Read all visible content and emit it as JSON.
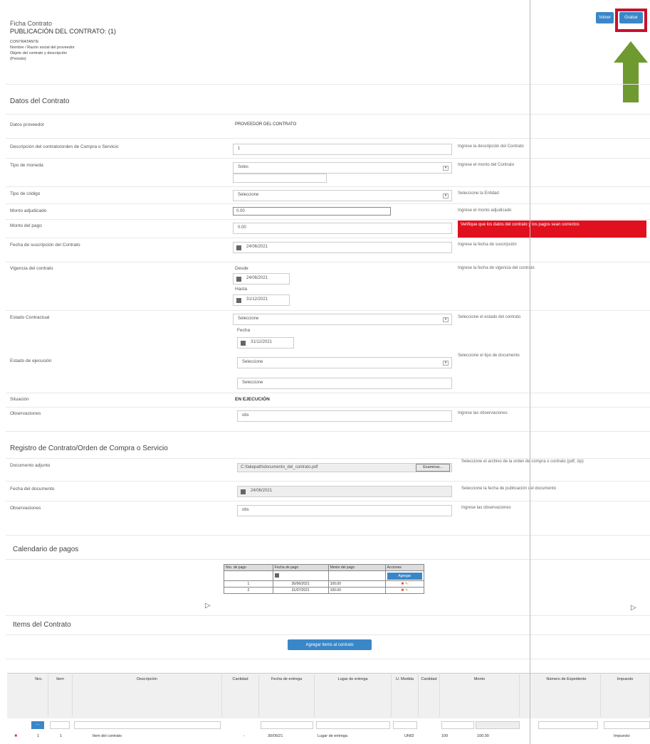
{
  "header": {
    "subtitle": "Ficha Contrato",
    "title": "PUBLICACIÓN DEL CONTRATO: (1)",
    "lines": [
      "CONTRATANTE",
      "Nombre / Razón social del proveedor",
      "Objeto del contrato y descripción",
      "(Periodo)"
    ]
  },
  "toolbar": {
    "back_label": "Volver",
    "save_label": "Grabar"
  },
  "sections": {
    "datos": "Datos del Contrato",
    "registro": "Registro de Contrato/Orden de Compra o Servicio",
    "calendario": "Calendario de pagos",
    "items": "Items del Contrato"
  },
  "form": {
    "proveedor_label": "Datos proveedor",
    "proveedor_value": "PROVEEDOR DEL CONTRATO",
    "descripcion_label": "Descripción del contrato/orden de Compra o Servicio",
    "descripcion_value": "1",
    "descripcion_help": "Ingrese la descripción del Contrato",
    "moneda_label": "Tipo de moneda",
    "moneda_value": "Soles",
    "moneda_help": "Ingrese el monto del Contrato",
    "codigo_label": "Tipo de código",
    "codigo_value": "Seleccione",
    "codigo_help": "Seleccione la Entidad",
    "monto_label": "Monto adjudicado",
    "monto_value": "0.00",
    "monto_help": "Ingrese el monto adjudicado",
    "pago_label": "Monto del pago",
    "pago_value": "0.00",
    "pago_alert": "Verifique que los datos del contrato y los pagos sean correctos",
    "fecha_label": "Fecha de suscripción del Contrato",
    "fecha_value": "24/06/2021",
    "fecha_help": "Ingrese la fecha de suscripción",
    "vigencia_label": "Vigencia del contrato",
    "vigencia_desde_label": "Desde",
    "vigencia_desde": "24/06/2021",
    "vigencia_hasta_label": "Hasta",
    "vigencia_hasta": "31/12/2021",
    "vigencia_help": "Ingrese la fecha de vigencia del contrato",
    "estado_label": "Estado Contractual",
    "estado_value": "Seleccione",
    "estado_help": "Seleccione el estado del contrato",
    "fecha2_label": "Fecha",
    "fecha2_value": "31/12/2021",
    "estado2_label": "Estado de ejecución",
    "estado2_value": "Seleccione",
    "estado2_help": "Seleccione el tipo de documento",
    "estado2_extra": "Seleccione",
    "situacion_label": "Situación",
    "situacion_value": "EN EJECUCIÓN",
    "obs_label": "Observaciones",
    "obs_value": "obs",
    "obs_help": "Ingrese las observaciones"
  },
  "registro": {
    "archivo_label": "Documento adjunto",
    "archivo_value": "C:\\fakepath\\documento_del_contrato.pdf",
    "archivo_button": "Examinar...",
    "archivo_help": "Seleccione el archivo de la orden de compra o contrato (pdf, zip)",
    "fecha_label": "Fecha del documento",
    "fecha_value": "24/06/2021",
    "fecha_help": "Seleccione la fecha de publicación del documento",
    "obs_label": "Observaciones",
    "obs_value": "obs",
    "obs_help": "Ingrese las observaciones"
  },
  "calendario": {
    "headers": [
      "Nro. de pago",
      "Fecha de pago",
      "Monto del pago",
      "Acciones"
    ],
    "add_label": "Agregar",
    "rows": [
      [
        "1",
        "30/06/2021",
        "100.00"
      ],
      [
        "2",
        "31/07/2021",
        "100.00"
      ]
    ]
  },
  "items": {
    "add_button": "Agregar items al contrato",
    "headers": [
      "Nro.",
      "Item",
      "Descripción",
      "Cantidad",
      "Fecha de entrega",
      "Lugar de entrega",
      "U. Medida",
      "Cantidad",
      "Monto",
      "Número de Expediente",
      "Impuesto"
    ],
    "row": [
      "1",
      "1",
      "Item del contrato",
      "-",
      "30/06/21",
      "Lugar de entrega",
      "UNID",
      "100",
      "100.00",
      "",
      "Impuesto"
    ]
  }
}
